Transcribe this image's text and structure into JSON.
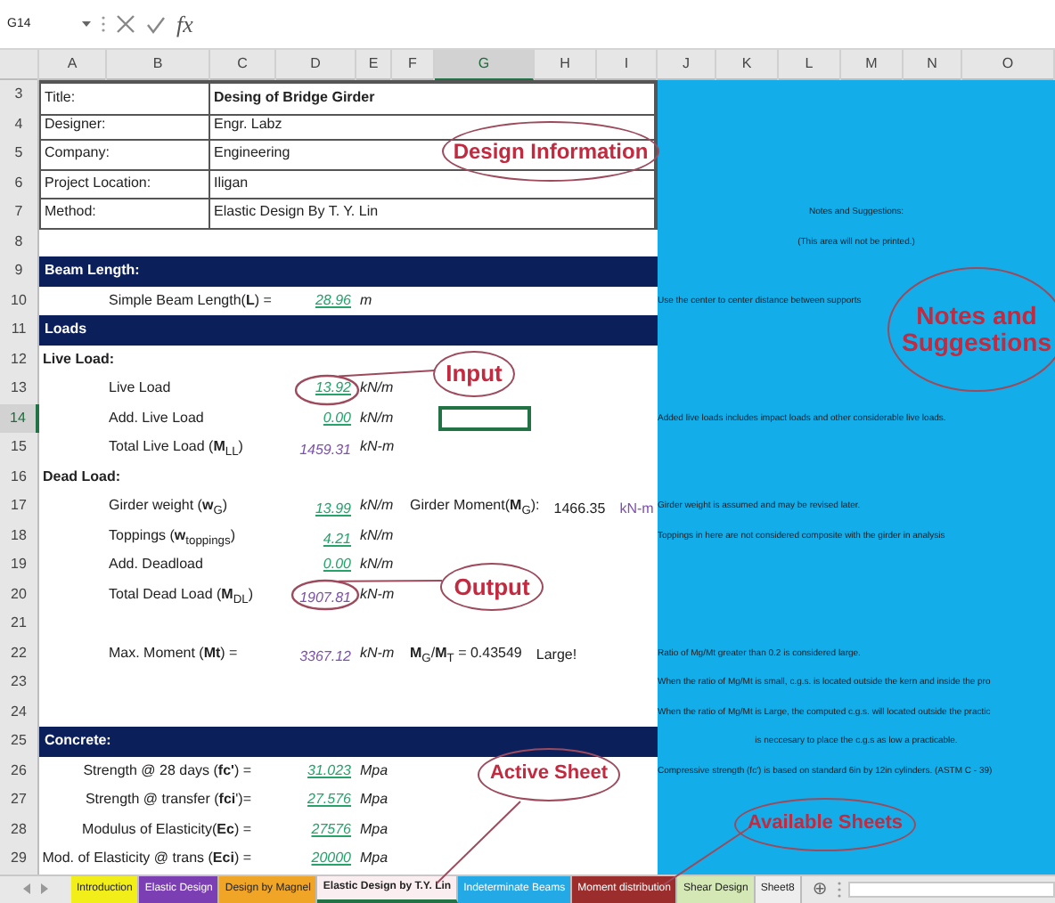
{
  "formula_bar": {
    "name_box": "G14",
    "function_label": "fx"
  },
  "columns": [
    {
      "label": "A",
      "selected": false
    },
    {
      "label": "B",
      "selected": false
    },
    {
      "label": "C",
      "selected": false
    },
    {
      "label": "D",
      "selected": false
    },
    {
      "label": "E",
      "selected": false
    },
    {
      "label": "F",
      "selected": false
    },
    {
      "label": "G",
      "selected": true
    },
    {
      "label": "H",
      "selected": false
    },
    {
      "label": "I",
      "selected": false
    },
    {
      "label": "J",
      "selected": false
    },
    {
      "label": "K",
      "selected": false
    },
    {
      "label": "L",
      "selected": false
    },
    {
      "label": "M",
      "selected": false
    },
    {
      "label": "N",
      "selected": false
    },
    {
      "label": "O",
      "selected": false
    }
  ],
  "rows": [
    {
      "num": "3",
      "kind": "info",
      "label": "Title:",
      "value": "Desing of Bridge Girder",
      "bold": true,
      "selected": false
    },
    {
      "num": "4",
      "kind": "info",
      "label": "Designer:",
      "value": "Engr. Labz",
      "bold": false,
      "selected": false
    },
    {
      "num": "5",
      "kind": "info",
      "label": "Company:",
      "value": "Engineering",
      "bold": false,
      "selected": false
    },
    {
      "num": "6",
      "kind": "info",
      "label": "Project Location:",
      "value": "Iligan",
      "bold": false,
      "selected": false
    },
    {
      "num": "7",
      "kind": "info",
      "label": "Method:",
      "value": "Elastic Design By T. Y. Lin",
      "bold": false,
      "selected": false,
      "note": {
        "text": "Notes and Suggestions:",
        "centered": true
      }
    },
    {
      "num": "8",
      "kind": "blank",
      "selected": false,
      "note": {
        "text": "(This area will not be printed.)",
        "centered": true
      }
    },
    {
      "num": "9",
      "kind": "section",
      "label": "Beam Length:",
      "selected": false
    },
    {
      "num": "10",
      "kind": "param",
      "label": "Simple Beam Length(**L**) =",
      "value": "28.96",
      "output": false,
      "unit": "m",
      "selected": false,
      "note": {
        "text": "Use the center to center distance between supports",
        "centered": false
      }
    },
    {
      "num": "11",
      "kind": "section",
      "label": "Loads",
      "selected": false
    },
    {
      "num": "12",
      "kind": "subhead",
      "label": "Live Load:",
      "selected": false
    },
    {
      "num": "13",
      "kind": "param",
      "label": "Live Load",
      "value": "13.92",
      "output": false,
      "unit": "kN/m",
      "selected": false
    },
    {
      "num": "14",
      "kind": "param",
      "label": "Add. Live Load",
      "value": "0.00",
      "output": false,
      "unit": "kN/m",
      "selected": true,
      "note": {
        "text": "Added live loads includes impact loads and other considerable live loads.",
        "centered": false
      }
    },
    {
      "num": "15",
      "kind": "param",
      "label": "Total Live Load (**M**$_{LL}$)",
      "value": "1459.31",
      "output": true,
      "unit": "kN-m",
      "selected": false
    },
    {
      "num": "16",
      "kind": "subhead",
      "label": "Dead Load:",
      "selected": false
    },
    {
      "num": "17",
      "kind": "param",
      "label": "Girder weight (**w**$_{G}$)",
      "value": "13.99",
      "output": false,
      "unit": "kN/m",
      "selected": false,
      "extra": {
        "label": "Girder Moment(**M**$_{G}$):",
        "value": "1466.35",
        "unit": "kN-m"
      },
      "note": {
        "text": "Girder weight is assumed and may be revised later.",
        "centered": false
      }
    },
    {
      "num": "18",
      "kind": "param",
      "label": "Toppings (**w**$_{toppings}$)",
      "value": "4.21",
      "output": false,
      "unit": "kN/m",
      "selected": false,
      "note": {
        "text": "Toppings in here are not considered composite with the girder in analysis",
        "centered": false
      }
    },
    {
      "num": "19",
      "kind": "param",
      "label": "Add. Deadload",
      "value": "0.00",
      "output": false,
      "unit": "kN/m",
      "selected": false
    },
    {
      "num": "20",
      "kind": "param",
      "label": "Total Dead Load (**M**$_{DL}$)",
      "value": "1907.81",
      "output": true,
      "unit": "kN-m",
      "selected": false
    },
    {
      "num": "21",
      "kind": "blank",
      "selected": false
    },
    {
      "num": "22",
      "kind": "param",
      "label": "Max. Moment (**Mt**) =",
      "value": "3367.12",
      "output": true,
      "unit": "kN-m",
      "selected": false,
      "extra": {
        "label": "**M**$_{G}$/**M**$_{T}$ = 0.43549",
        "value": "Large!"
      },
      "note": {
        "text": "Ratio of Mg/Mt greater than 0.2 is considered large.",
        "centered": false
      }
    },
    {
      "num": "23",
      "kind": "blank",
      "selected": false,
      "note": {
        "text": "When the ratio of Mg/Mt is small, c.g.s. is located outside the kern and inside the pro",
        "centered": false
      }
    },
    {
      "num": "24",
      "kind": "blank",
      "selected": false,
      "note": {
        "text": "When the ratio of Mg/Mt is Large, the computed c.g.s. will located outside the practic",
        "centered": false
      }
    },
    {
      "num": "25",
      "kind": "section",
      "label": "Concrete:",
      "selected": false,
      "note": {
        "text": "is neccesary to place the c.g.s as low a practicable.",
        "centered": true
      }
    },
    {
      "num": "26",
      "kind": "param-right",
      "label": "Strength @ 28 days (**fc'**) =",
      "value": "31.023",
      "output": false,
      "unit": "Mpa",
      "selected": false,
      "note": {
        "text": "Compressive strength (fc') is based on standard 6in by 12in cylinders. (ASTM C - 39)",
        "centered": false
      }
    },
    {
      "num": "27",
      "kind": "param-right",
      "label": "Strength @ transfer (**fci**')=",
      "value": "27.576",
      "output": false,
      "unit": "Mpa",
      "selected": false
    },
    {
      "num": "28",
      "kind": "param-right",
      "label": "Modulus of Elasticity(**Ec**) =",
      "value": "27576",
      "output": false,
      "unit": "Mpa",
      "selected": false
    },
    {
      "num": "29",
      "kind": "param-right",
      "label": "Mod. of Elasticity @ trans (**Eci**) =",
      "value": "20000",
      "output": false,
      "unit": "Mpa",
      "selected": false
    }
  ],
  "sheet_tabs": [
    {
      "label": "Introduction",
      "color": "#f2ee1a",
      "selected": false
    },
    {
      "label": "Elastic Design",
      "color": "#7b3fb3",
      "selected": false
    },
    {
      "label": "Design by Magnel",
      "color": "#f0a526",
      "selected": false
    },
    {
      "label": "Elastic Design by T.Y. Lin",
      "color": "#fbeef0",
      "selected": true
    },
    {
      "label": "Indeterminate Beams",
      "color": "#22a9e6",
      "selected": false
    },
    {
      "label": "Moment distribution",
      "color": "#9c2d2d",
      "selected": false
    },
    {
      "label": "Shear Design",
      "color": "#d3e8b4",
      "selected": false
    },
    {
      "label": "Sheet8",
      "color": "#eeeeee",
      "selected": false
    }
  ],
  "add_sheet": "⊕",
  "annotations": [
    {
      "text": "Design Information"
    },
    {
      "text": "Input"
    },
    {
      "text": "Output"
    },
    {
      "text": "Notes and Suggestions"
    },
    {
      "text": "Active Sheet"
    },
    {
      "text": "Available Sheets"
    }
  ]
}
